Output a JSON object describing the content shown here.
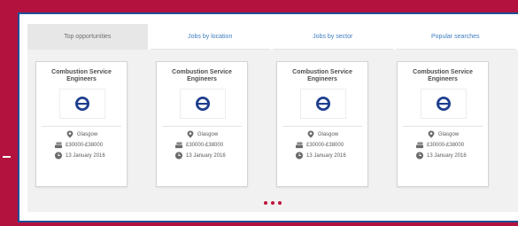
{
  "tabs": [
    {
      "label": "Top opportunities",
      "active": true
    },
    {
      "label": "Jobs by location",
      "active": false
    },
    {
      "label": "Jobs by sector",
      "active": false
    },
    {
      "label": "Popular searches",
      "active": false
    }
  ],
  "cards": [
    {
      "title": "Combustion Service Engineers",
      "location": "Glasgow",
      "salary": "£30000-£38000",
      "date": "13 January 2016",
      "logo": "company-logo-icon"
    },
    {
      "title": "Combustion Service Engineers",
      "location": "Glasgow",
      "salary": "£30000-£38000",
      "date": "13 January 2016",
      "logo": "company-logo-icon"
    },
    {
      "title": "Combustion Service Engineers",
      "location": "Glasgow",
      "salary": "£30000-£38000",
      "date": "13 January 2016",
      "logo": "company-logo-icon"
    },
    {
      "title": "Combustion Service Engineers",
      "location": "Glasgow",
      "salary": "£30000-£38000",
      "date": "13 January 2016",
      "logo": "company-logo-icon"
    }
  ],
  "pagination": {
    "dot_count": 3
  },
  "colors": {
    "background": "#b3123e",
    "frame_border": "#1f4f97",
    "tab_link": "#3f7cc0",
    "accent_dots": "#c0143c",
    "logo_blue": "#1f3f8f"
  }
}
